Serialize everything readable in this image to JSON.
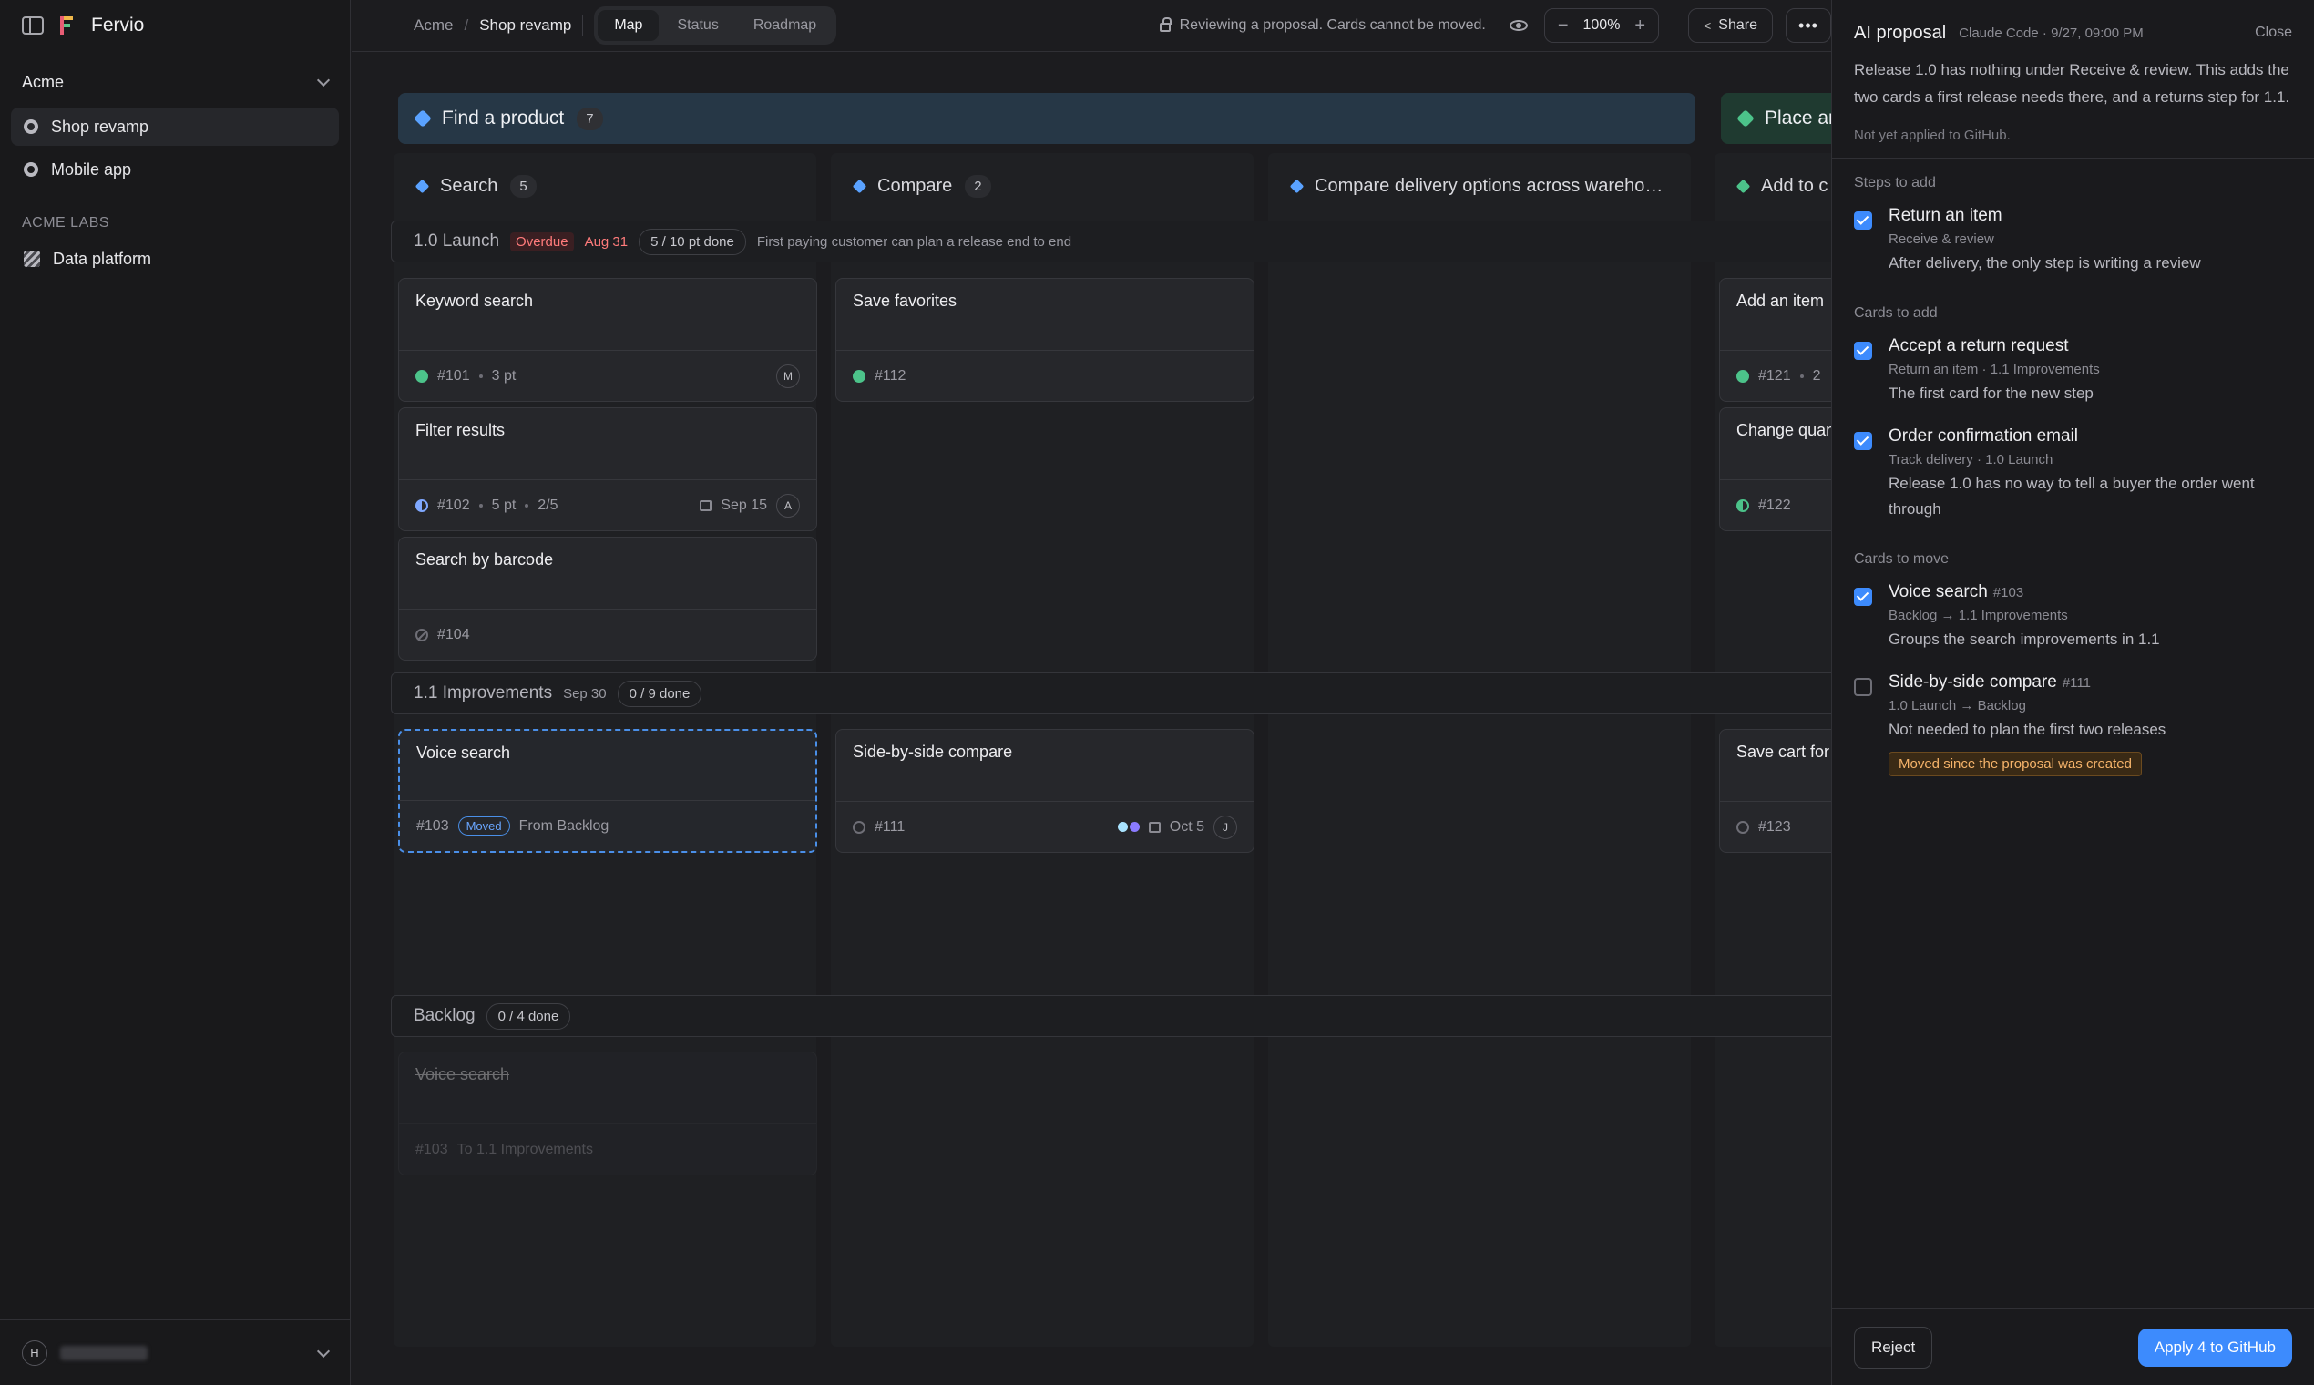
{
  "sidebar": {
    "brand": "Fervio",
    "workspace": "Acme",
    "items": [
      {
        "label": "Shop revamp"
      },
      {
        "label": "Mobile app"
      }
    ],
    "section_label": "ACME LABS",
    "section_items": [
      {
        "label": "Data platform"
      }
    ],
    "user_initial": "H"
  },
  "topbar": {
    "crumb_root": "Acme",
    "crumb_sep": "/",
    "crumb_current": "Shop revamp",
    "views": [
      "Map",
      "Status",
      "Roadmap"
    ],
    "review_text": "Reviewing a proposal. Cards cannot be moved.",
    "zoom": "100%",
    "zoom_minus": "−",
    "zoom_plus": "+",
    "share": "Share",
    "more": "•••"
  },
  "board": {
    "activities": [
      {
        "name": "Find a product",
        "count": "7",
        "color": "#263746",
        "cube": "#5aa2ff"
      },
      {
        "name": "Place an",
        "count": "",
        "color": "#1f3a30",
        "cube": "#4cc38a"
      }
    ],
    "steps": [
      {
        "name": "Search",
        "count": "5",
        "dia": "#5aa2ff"
      },
      {
        "name": "Compare",
        "count": "2",
        "dia": "#5aa2ff"
      },
      {
        "name": "Compare delivery options across wareho…",
        "count": "",
        "dia": "#5aa2ff"
      },
      {
        "name": "Add to c",
        "count": "",
        "dia": "#4cc38a"
      }
    ],
    "releases": [
      {
        "name": "1.0 Launch",
        "overdue": "Overdue",
        "date": "Aug 31",
        "progress": "5 / 10 pt done",
        "desc": "First paying customer can plan a release end to end"
      },
      {
        "name": "1.1 Improvements",
        "date": "Sep 30",
        "progress": "0 / 9 done"
      },
      {
        "name": "Backlog",
        "progress": "0 / 4 done"
      }
    ],
    "cards": {
      "keyword": {
        "title": "Keyword search",
        "num": "#101",
        "pts": "3 pt",
        "assignee": "M"
      },
      "filter": {
        "title": "Filter results",
        "num": "#102",
        "pts": "5 pt",
        "sub": "2/5",
        "date": "Sep 15",
        "assignee": "A"
      },
      "barcode": {
        "title": "Search by barcode",
        "num": "#104"
      },
      "favorites": {
        "title": "Save favorites",
        "num": "#112"
      },
      "additem": {
        "title": "Add an item",
        "num": "#121",
        "pts": "2"
      },
      "changeq": {
        "title": "Change quan",
        "num": "#122"
      },
      "voice": {
        "title": "Voice search",
        "num": "#103",
        "tag": "Moved",
        "from": "From Backlog"
      },
      "sbs": {
        "title": "Side-by-side compare",
        "num": "#111",
        "date": "Oct 5",
        "assignee": "J"
      },
      "savecart": {
        "title": "Save cart for",
        "num": "#123"
      },
      "ghost": {
        "title": "Voice search",
        "num": "#103",
        "to": "To 1.1 Improvements"
      }
    }
  },
  "panel": {
    "title": "AI proposal",
    "meta": "Claude Code · 9/27, 09:00 PM",
    "close": "Close",
    "intro": "Release 1.0 has nothing under Receive & review. This adds the two cards a first release needs there, and a returns step for 1.1.",
    "note": "Not yet applied to GitHub.",
    "groups": {
      "steps": "Steps to add",
      "cards_add": "Cards to add",
      "cards_move": "Cards to move"
    },
    "items": [
      {
        "name": "Return an item",
        "num": "",
        "sub": "Receive & review",
        "desc": "After delivery, the only step is writing a review",
        "checked": true
      },
      {
        "name": "Accept a return request",
        "num": "",
        "sub": "Return an item · 1.1 Improvements",
        "desc": "The first card for the new step",
        "checked": true
      },
      {
        "name": "Order confirmation email",
        "num": "",
        "sub": "Track delivery · 1.0 Launch",
        "desc": "Release 1.0 has no way to tell a buyer the order went through",
        "checked": true
      },
      {
        "name": "Voice search",
        "num": "#103",
        "sub": "Backlog → 1.1 Improvements",
        "desc": "Groups the search improvements in 1.1",
        "checked": true
      },
      {
        "name": "Side-by-side compare",
        "num": "#111",
        "sub": "1.0 Launch → Backlog",
        "desc": "Not needed to plan the first two releases",
        "checked": false,
        "warning": "Moved since the proposal was created"
      }
    ],
    "reject": "Reject",
    "apply": "Apply 4 to GitHub"
  }
}
